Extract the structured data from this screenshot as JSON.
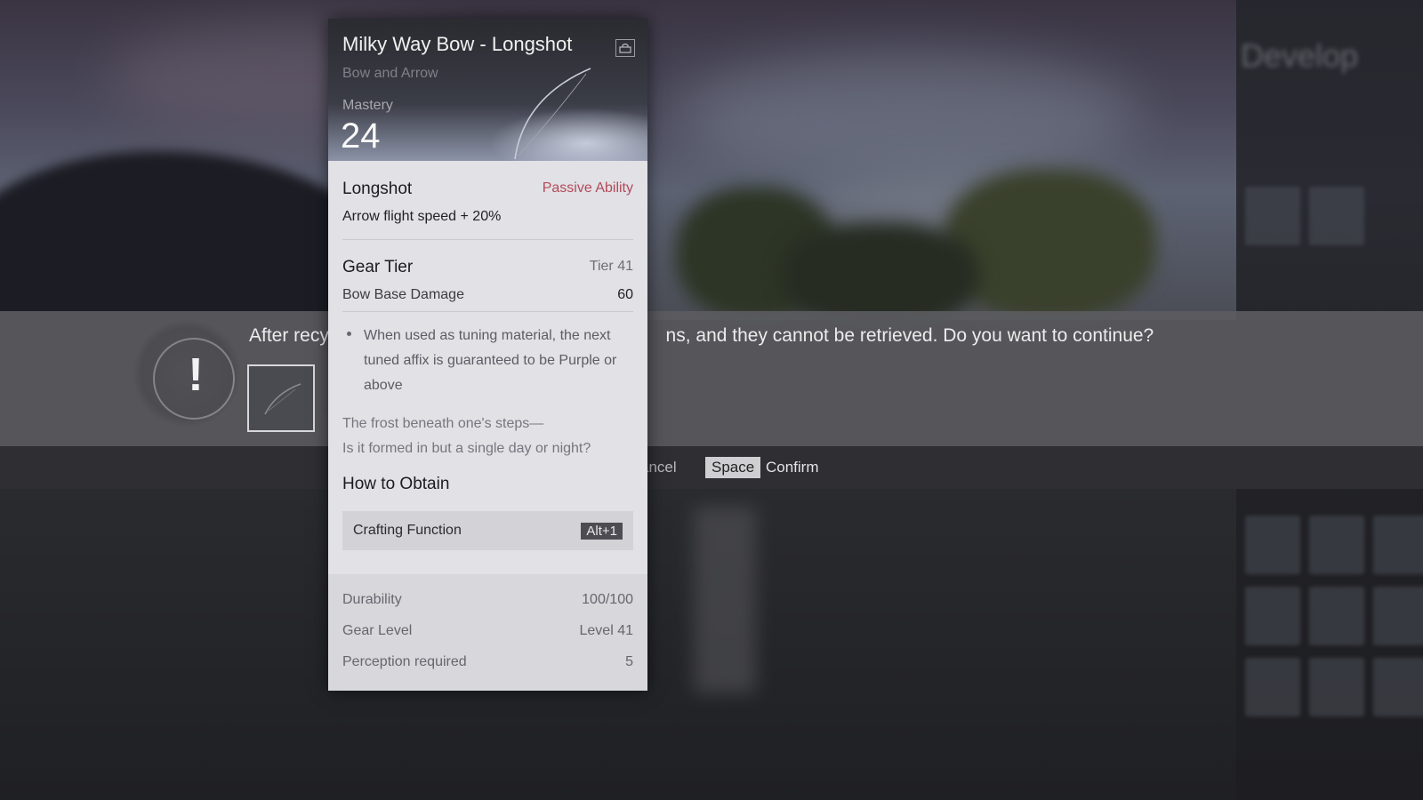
{
  "background": {
    "panel_title": "Develop"
  },
  "item": {
    "name": "Milky Way Bow - Longshot",
    "type": "Bow and Arrow",
    "mastery_label": "Mastery",
    "mastery_value": "24",
    "passive": {
      "name": "Longshot",
      "tag": "Passive Ability",
      "description": "Arrow flight speed + 20%"
    },
    "gear_tier": {
      "label": "Gear Tier",
      "value": "Tier 41",
      "damage_label": "Bow Base Damage",
      "damage_value": "60"
    },
    "affix_note": "When used as tuning material, the next tuned affix is guaranteed to be Purple or above",
    "flavor_line_1": "The frost beneath one's steps—",
    "flavor_line_2": "Is it formed in but a single day or night?",
    "obtain": {
      "title": "How to Obtain",
      "source": "Crafting Function",
      "hotkey": "Alt+1"
    },
    "stats": [
      {
        "label": "Durability",
        "value": "100/100"
      },
      {
        "label": "Gear Level",
        "value": "Level 41"
      },
      {
        "label": "Perception required",
        "value": "5"
      }
    ]
  },
  "dialog": {
    "message_visible_left": "After recy",
    "message_visible_right": "ns, and they cannot be retrieved. Do you want to continue?",
    "cancel_label": "ancel",
    "confirm_key": "Space",
    "confirm_label": "Confirm"
  },
  "colors": {
    "passive_accent": "#b44a5a",
    "card_body": "#e1e1e6",
    "dialog_strip": "#5c5c60"
  },
  "icons": {
    "lock": "lock-icon",
    "warning": "exclamation-icon"
  }
}
